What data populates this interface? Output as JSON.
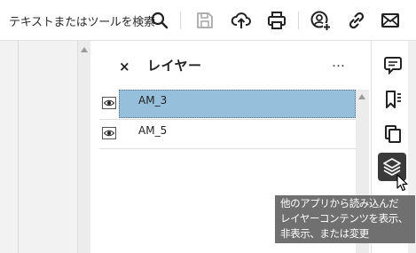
{
  "toolbar": {
    "search_label": "テキストまたはツールを検索",
    "icons": [
      "search-icon",
      "save-icon",
      "upload-icon",
      "print-icon",
      "add-user-icon",
      "link-icon",
      "mail-icon"
    ]
  },
  "layers_panel": {
    "close_symbol": "×",
    "title": "レイヤー",
    "more_symbol": "…",
    "layers": [
      {
        "name": "AM_3",
        "visible": true,
        "selected": true
      },
      {
        "name": "AM_5",
        "visible": true,
        "selected": false
      }
    ]
  },
  "right_sidebar": {
    "icons": [
      "comment-icon",
      "bookmark-icon",
      "pages-icon",
      "layers-icon"
    ],
    "active": "layers-icon"
  },
  "tooltip": {
    "lines": [
      "他のアプリから読み込んだ",
      "レイヤーコンテンツを表示、",
      "非表示、または変更"
    ]
  },
  "colors": {
    "selected_row": "#95bfdb",
    "tooltip_bg": "#707070",
    "active_icon_bg": "#3a3a3a"
  }
}
